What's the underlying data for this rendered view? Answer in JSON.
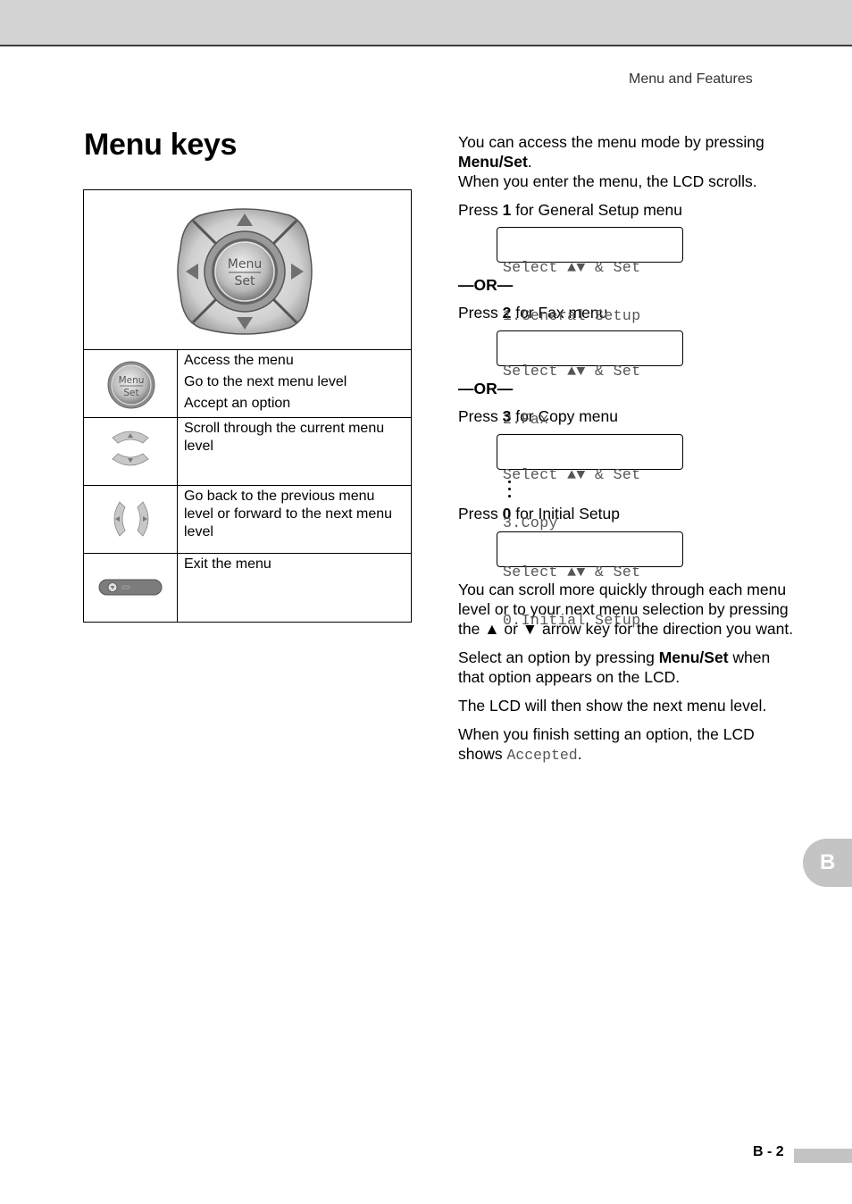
{
  "header": {
    "running_head": "Menu and Features"
  },
  "title": "Menu keys",
  "dpad": {
    "center_top": "Menu",
    "center_bottom": "Set"
  },
  "table": {
    "rows": [
      {
        "icon": "menu-set-button-icon",
        "icon_label_top": "Menu",
        "icon_label_bottom": "Set",
        "lines": [
          "Access the menu",
          "Go to the next menu level",
          "Accept an option"
        ]
      },
      {
        "icon": "up-down-arrow-keys-icon",
        "lines": [
          "Scroll through the current menu",
          "level"
        ]
      },
      {
        "icon": "left-right-arrow-keys-icon",
        "lines": [
          "Go back to the previous menu",
          "level or forward to the next menu",
          "level"
        ]
      },
      {
        "icon": "stop-exit-button-icon",
        "lines": [
          "Exit the menu"
        ]
      }
    ]
  },
  "right": {
    "intro_1": "You can access the menu mode by pressing",
    "intro_bold": "Menu/Set",
    "intro_period": ".",
    "intro_2": "When you enter the menu, the LCD scrolls.",
    "steps": [
      {
        "prefix": "Press ",
        "key": "1",
        "suffix": " for General Setup menu",
        "lcd_line1": "Select ▲▼ & Set",
        "lcd_line2": "1.General Setup"
      },
      {
        "prefix": "Press ",
        "key": "2",
        "suffix": " for Fax menu",
        "lcd_line1": "Select ▲▼ & Set",
        "lcd_line2": "2.Fax"
      },
      {
        "prefix": "Press ",
        "key": "3",
        "suffix": " for Copy menu",
        "lcd_line1": "Select ▲▼ & Set",
        "lcd_line2": "3.Copy"
      },
      {
        "prefix": "Press ",
        "key": "0",
        "suffix": " for Initial Setup",
        "lcd_line1": "Select ▲▼ & Set",
        "lcd_line2": "0.Initial Setup"
      }
    ],
    "or_label": "—OR—",
    "ellipsis": "⋮",
    "scroll_para": "You can scroll more quickly through each menu level or to your next menu selection by pressing the ▲ or ▼ arrow key for the direction you want.",
    "select_pre": "Select an option by pressing ",
    "select_bold": "Menu/Set",
    "select_post": " when that option appears on the LCD.",
    "next_level": "The LCD will then show the next menu level.",
    "finish_pre": "When you finish setting an option, the LCD shows ",
    "finish_mono": "Accepted",
    "finish_post": "."
  },
  "side_tab": "B",
  "footer": {
    "page_number": "B - 2"
  }
}
